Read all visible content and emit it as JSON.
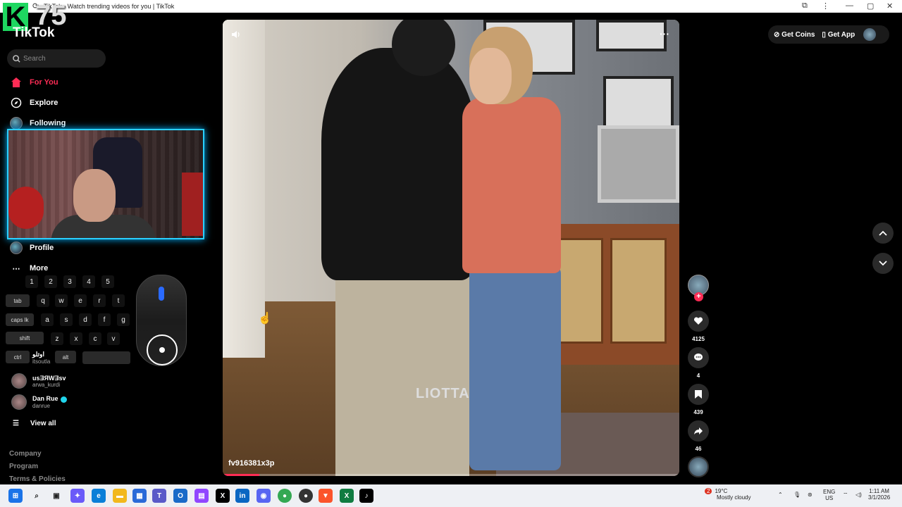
{
  "window": {
    "title": "TikTok - Watch trending videos for you | TikTok"
  },
  "overlay": {
    "badge_letter": "K",
    "badge_number": "75"
  },
  "brand": {
    "logo": "TikTok"
  },
  "search": {
    "placeholder": "Search"
  },
  "nav": [
    {
      "label": "For You",
      "icon": "home-icon",
      "active": true
    },
    {
      "label": "Explore",
      "icon": "compass-icon",
      "active": false
    },
    {
      "label": "Following",
      "icon": "following-avatar",
      "active": false
    },
    {
      "label": "Profile",
      "icon": "profile-avatar",
      "active": false
    },
    {
      "label": "More",
      "icon": "more-icon",
      "active": false
    }
  ],
  "keyboard": {
    "number_row": [
      "1",
      "2",
      "3",
      "4",
      "5"
    ],
    "row_tab": {
      "mod": "tab",
      "keys": [
        "q",
        "w",
        "e",
        "r",
        "t"
      ]
    },
    "row_caps": {
      "mod": "caps lk",
      "keys": [
        "a",
        "s",
        "d",
        "f",
        "g"
      ]
    },
    "row_shift": {
      "mod": "shift",
      "keys": [
        "z",
        "x",
        "c",
        "v"
      ]
    },
    "row_ctrl": {
      "mod": "ctrl",
      "alt": "alt"
    }
  },
  "following_accounts": [
    {
      "name": "usƎЯWƎsv",
      "handle": "arwa_kurdi",
      "verified": false
    },
    {
      "name": "Dan Rue",
      "handle": "danrue",
      "verified": true
    }
  ],
  "partial_account": {
    "name": "اوتلو",
    "handle": "itsoutla"
  },
  "view_all": "View all",
  "footer": [
    "Company",
    "Program",
    "Terms & Policies"
  ],
  "video": {
    "username": "fv916381x3p",
    "watermark": "LIOTTA",
    "progress": 0.08
  },
  "actions": {
    "likes": "4125",
    "comments": "4",
    "saves": "439",
    "shares": "46"
  },
  "topbar": {
    "get_coins": "Get Coins",
    "get_app": "Get App"
  },
  "taskbar": {
    "weather_temp": "19°C",
    "weather_desc": "Mostly cloudy",
    "weather_badge": "2",
    "lang": "ENG",
    "region": "US",
    "time": "1:11 AM",
    "date": "3/1/2026",
    "apps": [
      "start",
      "search",
      "task-view",
      "copilot",
      "edge",
      "explorer",
      "store",
      "teams",
      "outlook",
      "twitch",
      "x",
      "linkedin",
      "discord",
      "chrome",
      "chrome-dev",
      "brave",
      "excel",
      "tiktok"
    ]
  },
  "colors": {
    "accent": "#fe2c55",
    "webcam_border": "#2ad0ff"
  }
}
